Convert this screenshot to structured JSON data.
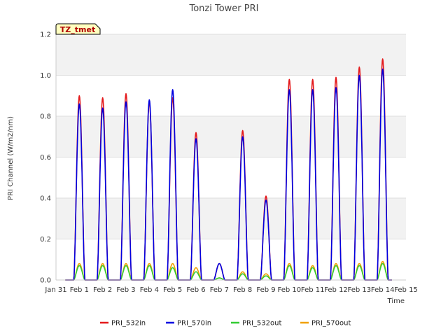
{
  "chart_data": {
    "type": "line",
    "title": "Tonzi Tower PRI",
    "xlabel": "Time",
    "ylabel": "PRI Channel (W/m2/nm)",
    "annotation": "TZ_tmet",
    "xlim": [
      0,
      15
    ],
    "ylim": [
      0,
      1.2
    ],
    "grid": "horizontal bands",
    "legend_position": "bottom",
    "x_ticks": [
      {
        "x": 0,
        "label": "Jan 31"
      },
      {
        "x": 1,
        "label": "Feb 1"
      },
      {
        "x": 2,
        "label": "Feb 2"
      },
      {
        "x": 3,
        "label": "Feb 3"
      },
      {
        "x": 4,
        "label": "Feb 4"
      },
      {
        "x": 5,
        "label": "Feb 5"
      },
      {
        "x": 6,
        "label": "Feb 6"
      },
      {
        "x": 7,
        "label": "Feb 7"
      },
      {
        "x": 8,
        "label": "Feb 8"
      },
      {
        "x": 9,
        "label": "Feb 9"
      },
      {
        "x": 10,
        "label": "Feb 10"
      },
      {
        "x": 11,
        "label": "Feb 11"
      },
      {
        "x": 12,
        "label": "Feb 12"
      },
      {
        "x": 13,
        "label": "Feb 13"
      },
      {
        "x": 14,
        "label": "Feb 14"
      },
      {
        "x": 15,
        "label": "Feb 15"
      }
    ],
    "y_ticks": [
      {
        "y": 0.0,
        "label": "0.0"
      },
      {
        "y": 0.2,
        "label": "0.2"
      },
      {
        "y": 0.4,
        "label": "0.4"
      },
      {
        "y": 0.6,
        "label": "0.6"
      },
      {
        "y": 0.8,
        "label": "0.8"
      },
      {
        "y": 1.0,
        "label": "1.0"
      },
      {
        "y": 1.2,
        "label": "1.2"
      }
    ],
    "x_start": 0.4,
    "x_end": 14.4,
    "days": [
      {
        "day": 0,
        "in532": 0.9,
        "in570": 0.86,
        "out532": 0.07,
        "out570": 0.08
      },
      {
        "day": 1,
        "in532": 0.89,
        "in570": 0.84,
        "out532": 0.07,
        "out570": 0.08
      },
      {
        "day": 2,
        "in532": 0.91,
        "in570": 0.87,
        "out532": 0.07,
        "out570": 0.08
      },
      {
        "day": 3,
        "in532": 0.87,
        "in570": 0.88,
        "out532": 0.07,
        "out570": 0.08
      },
      {
        "day": 4,
        "in532": 0.89,
        "in570": 0.93,
        "out532": 0.06,
        "out570": 0.08
      },
      {
        "day": 5,
        "in532": 0.72,
        "in570": 0.69,
        "out532": 0.04,
        "out570": 0.06
      },
      {
        "day": 6,
        "in532": 0.08,
        "in570": 0.08,
        "out532": 0.01,
        "out570": 0.01
      },
      {
        "day": 7,
        "in532": 0.73,
        "in570": 0.7,
        "out532": 0.03,
        "out570": 0.04
      },
      {
        "day": 8,
        "in532": 0.41,
        "in570": 0.39,
        "out532": 0.02,
        "out570": 0.03
      },
      {
        "day": 9,
        "in532": 0.98,
        "in570": 0.93,
        "out532": 0.07,
        "out570": 0.08
      },
      {
        "day": 10,
        "in532": 0.98,
        "in570": 0.93,
        "out532": 0.06,
        "out570": 0.07
      },
      {
        "day": 11,
        "in532": 0.99,
        "in570": 0.94,
        "out532": 0.07,
        "out570": 0.08
      },
      {
        "day": 12,
        "in532": 1.04,
        "in570": 1.0,
        "out532": 0.07,
        "out570": 0.08
      },
      {
        "day": 13,
        "in532": 1.08,
        "in570": 1.03,
        "out532": 0.08,
        "out570": 0.09
      }
    ],
    "series": [
      {
        "key": "in532",
        "name": "PRI_532in",
        "color": "#e41a1c"
      },
      {
        "key": "in570",
        "name": "PRI_570in",
        "color": "#0000e0"
      },
      {
        "key": "out532",
        "name": "PRI_532out",
        "color": "#33cc33"
      },
      {
        "key": "out570",
        "name": "PRI_570out",
        "color": "#f0a000"
      }
    ]
  }
}
